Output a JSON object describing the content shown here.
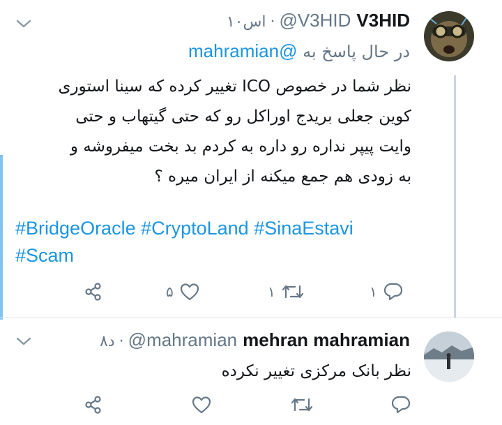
{
  "tweets": [
    {
      "display_name": "V3HID",
      "handle": "@V3HID",
      "time": "۱۰اس",
      "reply_prefix": "در حال پاسخ به",
      "reply_mention": "@mahramian",
      "body_lines": [
        "نظر شما در خصوص ICO تغییر کرده که سینا استوری",
        "کوین جعلی بریدج اوراکل رو که حتی گیتهاب و حتی",
        "وایت پیپر نداره رو داره به کردم بد بخت میفروشه و",
        "به زودی هم جمع میکنه از ایران میره ؟"
      ],
      "hashtags": [
        "#BridgeOracle",
        "#CryptoLand",
        "#SinaEstavi",
        "#Scam"
      ],
      "actions": {
        "reply_count": "۱",
        "retweet_count": "۱",
        "like_count": "۵"
      }
    },
    {
      "display_name": "mehran mahramian",
      "handle": "@mahramian",
      "time": "۸د",
      "body_lines": [
        "نظر بانک مرکزی تغییر نکرده"
      ],
      "actions": {
        "reply_count": "",
        "retweet_count": "",
        "like_count": ""
      }
    }
  ],
  "colors": {
    "link": "#1b95e0",
    "muted": "#657786",
    "divider": "#e1e8ed",
    "accent": "#7fc3ee"
  },
  "icons": [
    "chevron-down-icon",
    "reply-icon",
    "retweet-icon",
    "like-icon",
    "share-icon"
  ]
}
